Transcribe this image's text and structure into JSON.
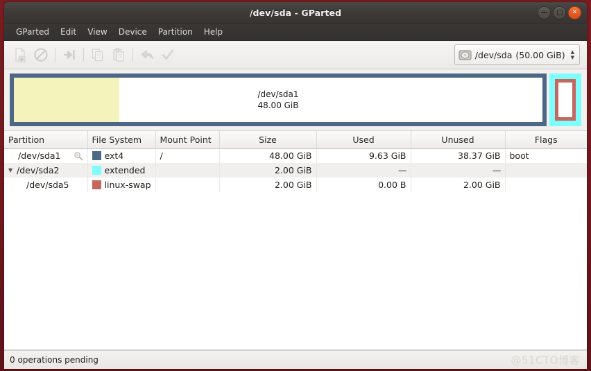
{
  "window": {
    "title": "/dev/sda - GParted",
    "controls": [
      {
        "name": "minimize",
        "glyph": "–"
      },
      {
        "name": "maximize",
        "glyph": "□"
      },
      {
        "name": "close",
        "glyph": "×"
      }
    ]
  },
  "menubar": {
    "items": [
      {
        "label": "GParted"
      },
      {
        "label": "Edit"
      },
      {
        "label": "View"
      },
      {
        "label": "Device"
      },
      {
        "label": "Partition"
      },
      {
        "label": "Help"
      }
    ]
  },
  "toolbar": {
    "buttons": [
      {
        "name": "new-partition-icon",
        "enabled": false
      },
      {
        "name": "delete-partition-icon",
        "enabled": false
      },
      {
        "name": "resize-move-icon",
        "enabled": false
      },
      {
        "name": "copy-icon",
        "enabled": false
      },
      {
        "name": "paste-icon",
        "enabled": false
      },
      {
        "name": "undo-icon",
        "enabled": false
      },
      {
        "name": "apply-icon",
        "enabled": false
      }
    ],
    "device_selector": {
      "device": "/dev/sda",
      "size": "(50.00 GiB)",
      "icon": "hard-disk-icon"
    }
  },
  "graphic": {
    "primary": {
      "name": "/dev/sda1",
      "size": "48.00 GiB",
      "border_color": "#4d6886",
      "used_color": "#f4f3bc",
      "used_fraction": 20
    },
    "extended": {
      "outer_color": "#7ffcfc",
      "inner_color": "#c4675e"
    }
  },
  "table": {
    "headers": [
      {
        "label": "Partition",
        "align": "l"
      },
      {
        "label": "File System",
        "align": "l"
      },
      {
        "label": "Mount Point",
        "align": "l"
      },
      {
        "label": "Size",
        "align": "c"
      },
      {
        "label": "Used",
        "align": "c"
      },
      {
        "label": "Unused",
        "align": "c"
      },
      {
        "label": "Flags",
        "align": "c"
      }
    ],
    "rows": [
      {
        "partition": "/dev/sda1",
        "filesystem": "ext4",
        "swatch": "#4d6886",
        "mount_point": "/",
        "size": "48.00 GiB",
        "used": "9.63 GiB",
        "unused": "38.37 GiB",
        "flags": "boot"
      },
      {
        "partition": "/dev/sda2",
        "filesystem": "extended",
        "swatch": "#7ffcfc",
        "mount_point": "",
        "size": "2.00 GiB",
        "used": "—",
        "unused": "—",
        "flags": ""
      },
      {
        "partition": "/dev/sda5",
        "filesystem": "linux-swap",
        "swatch": "#c4675e",
        "mount_point": "",
        "size": "2.00 GiB",
        "used": "0.00 B",
        "unused": "2.00 GiB",
        "flags": ""
      }
    ]
  },
  "statusbar": {
    "text": "0 operations pending",
    "watermark": "@51CTO博客"
  }
}
